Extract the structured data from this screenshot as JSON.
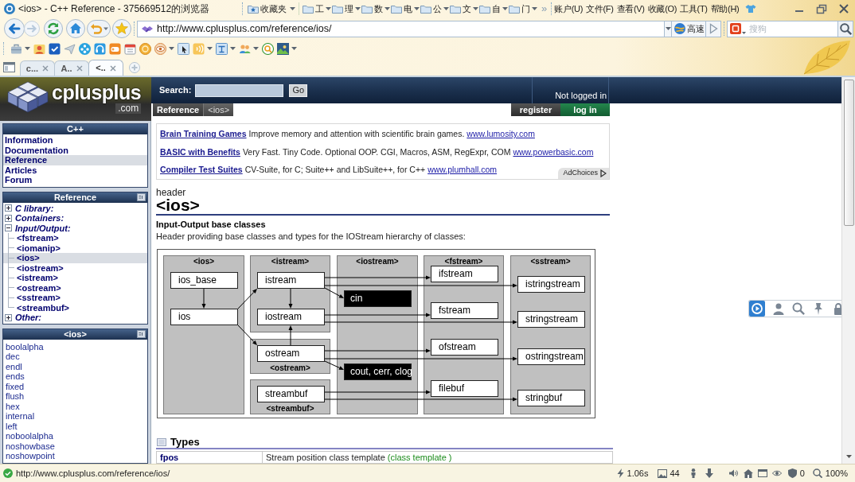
{
  "browser": {
    "title": "<ios> - C++ Reference - 375669512的浏览器",
    "favorites": {
      "label": "收藏夹",
      "folders": [
        "工",
        "理",
        "数",
        "电",
        "公",
        "文",
        "自",
        "门"
      ]
    },
    "more": "»",
    "menu": [
      "账户(U)",
      "文件(F)",
      "查看(V)",
      "收藏(O)",
      "工具(T)",
      "帮助(H)"
    ],
    "address": "http://www.cplusplus.com/reference/ios/",
    "speed_button": "高速",
    "search": {
      "placeholder": "搜狗"
    },
    "tabs": [
      {
        "label": "c...",
        "selected": false
      },
      {
        "label": "A..",
        "selected": false
      },
      {
        "label": "<..",
        "selected": true
      }
    ]
  },
  "page": {
    "logo": {
      "name": "cplusplus",
      "domain": ".com"
    },
    "search": {
      "label": "Search:",
      "button": "Go"
    },
    "login_status": "Not logged in",
    "breadcrumb": [
      "Reference",
      "<ios>"
    ],
    "account_buttons": [
      {
        "label": "register",
        "kind": "register"
      },
      {
        "label": "log in",
        "kind": "login"
      }
    ],
    "sidebar": {
      "nav": {
        "title": "C++",
        "items": [
          {
            "label": "Information",
            "selected": false
          },
          {
            "label": "Documentation",
            "selected": false
          },
          {
            "label": "Reference",
            "selected": true
          },
          {
            "label": "Articles",
            "selected": false
          },
          {
            "label": "Forum",
            "selected": false
          }
        ]
      },
      "reference": {
        "title": "Reference",
        "items": [
          {
            "label": "C library:",
            "expanded": false
          },
          {
            "label": "Containers:",
            "expanded": false
          },
          {
            "label": "Input/Output:",
            "expanded": true,
            "children": [
              {
                "label": "<fstream>",
                "selected": false
              },
              {
                "label": "<iomanip>",
                "selected": false
              },
              {
                "label": "<ios>",
                "selected": true
              },
              {
                "label": "<iostream>",
                "selected": false
              },
              {
                "label": "<istream>",
                "selected": false
              },
              {
                "label": "<ostream>",
                "selected": false
              },
              {
                "label": "<sstream>",
                "selected": false
              },
              {
                "label": "<streambuf>",
                "selected": false
              }
            ]
          },
          {
            "label": "Other:",
            "expanded": false
          }
        ]
      },
      "members": {
        "title": "<ios>",
        "items": [
          "boolalpha",
          "dec",
          "endl",
          "ends",
          "fixed",
          "flush",
          "hex",
          "internal",
          "left",
          "noboolalpha",
          "noshowbase",
          "noshowpoint"
        ]
      }
    },
    "ads": {
      "items": [
        {
          "title": "Brain Training Games",
          "text": "Improve memory and attention with scientific brain games.",
          "url": "www.lumosity.com"
        },
        {
          "title": "BASIC with Benefits",
          "text": "Very Fast. Tiny Code. Optional OOP. CGI, Macros, ASM, RegExpr, COM",
          "url": "www.powerbasic.com"
        },
        {
          "title": "Compiler Test Suites",
          "text": "CV-Suite, for C; Suite++ and LibSuite++, for C++",
          "url": "www.plumhall.com"
        }
      ],
      "adchoices": "AdChoices"
    },
    "article": {
      "kicker": "header",
      "title": "<ios>",
      "subtitle": "Input-Output base classes",
      "description": "Header providing base classes and types for the IOStream hierarchy of classes:",
      "diagram": {
        "panels": [
          {
            "label": "<ios>"
          },
          {
            "label": "<istream>"
          },
          {
            "label": "<iostream>"
          },
          {
            "label": "<fstream>"
          },
          {
            "label": "<sstream>"
          },
          {
            "label": "<ostream>"
          },
          {
            "label": "<streambuf>"
          }
        ],
        "nodes": [
          {
            "label": "ios_base",
            "kind": "class"
          },
          {
            "label": "ios",
            "kind": "class"
          },
          {
            "label": "istream",
            "kind": "class"
          },
          {
            "label": "iostream",
            "kind": "class"
          },
          {
            "label": "ostream",
            "kind": "class"
          },
          {
            "label": "streambuf",
            "kind": "class"
          },
          {
            "label": "cin",
            "kind": "object"
          },
          {
            "label": "cout, cerr, clog",
            "kind": "object"
          },
          {
            "label": "ifstream",
            "kind": "class"
          },
          {
            "label": "fstream",
            "kind": "class"
          },
          {
            "label": "ofstream",
            "kind": "class"
          },
          {
            "label": "filebuf",
            "kind": "class"
          },
          {
            "label": "istringstream",
            "kind": "class"
          },
          {
            "label": "stringstream",
            "kind": "class"
          },
          {
            "label": "ostringstream",
            "kind": "class"
          },
          {
            "label": "stringbuf",
            "kind": "class"
          }
        ]
      },
      "types": {
        "title": "Types",
        "rows": [
          {
            "name": "fpos",
            "description": "Stream position class template",
            "tag": "(class template )"
          }
        ]
      }
    }
  },
  "status_bar": {
    "url": "http://www.cplusplus.com/reference/ios/",
    "load_time": "1.06s",
    "images": "44",
    "blocked": "0",
    "zoom": "100%"
  }
}
